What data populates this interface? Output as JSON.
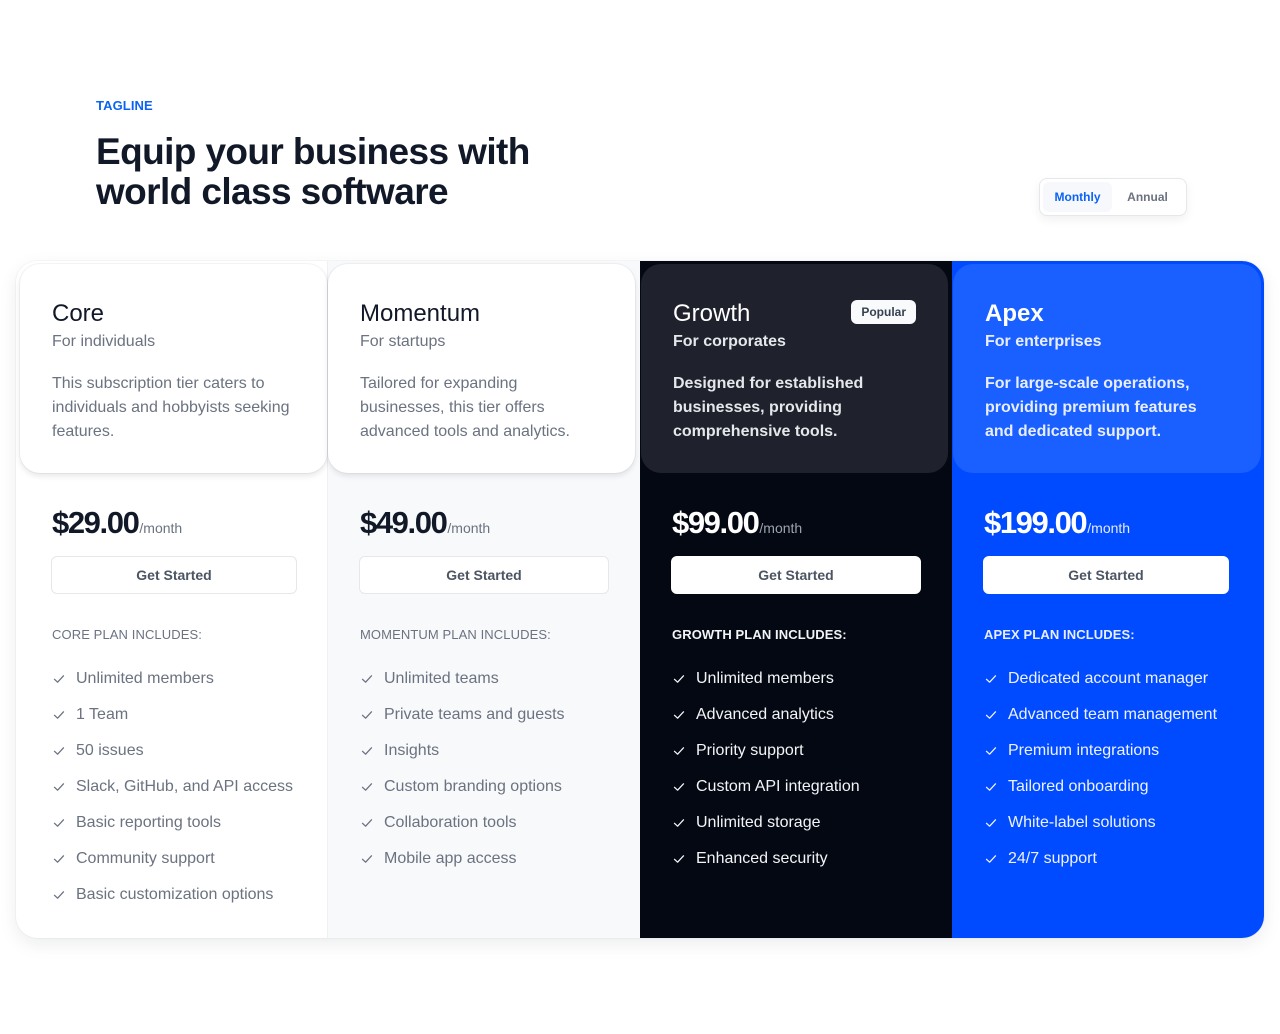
{
  "header": {
    "tagline": "TAGLINE",
    "title": "Equip your business with world class software"
  },
  "billing_toggle": {
    "options": [
      "Monthly",
      "Annual"
    ],
    "selected": "Monthly"
  },
  "colors": {
    "accent": "#0b63f6",
    "apex_bg": "#004bff",
    "growth_bg": "#040812"
  },
  "plans": [
    {
      "name": "Core",
      "audience": "For individuals",
      "description": "This subscription tier caters to individuals and hobbyists seeking features.",
      "price": "$29.00",
      "period": "/month",
      "cta": "Get Started",
      "includes_label": "CORE PLAN INCLUDES:",
      "features": [
        "Unlimited members",
        "1 Team",
        "50 issues",
        "Slack, GitHub, and API access",
        "Basic reporting tools",
        "Community support",
        "Basic customization options"
      ]
    },
    {
      "name": "Momentum",
      "audience": "For startups",
      "description": "Tailored for expanding businesses, this tier offers advanced tools and analytics.",
      "price": "$49.00",
      "period": "/month",
      "cta": "Get Started",
      "includes_label": "MOMENTUM PLAN INCLUDES:",
      "features": [
        "Unlimited teams",
        "Private teams and guests",
        "Insights",
        "Custom branding options",
        "Collaboration tools",
        "Mobile app access"
      ]
    },
    {
      "name": "Growth",
      "audience": "For corporates",
      "badge": "Popular",
      "description": "Designed for established businesses, providing comprehensive tools.",
      "price": "$99.00",
      "period": "/month",
      "cta": "Get Started",
      "includes_label": "GROWTH PLAN INCLUDES:",
      "features": [
        "Unlimited members",
        "Advanced analytics",
        "Priority support",
        "Custom API integration",
        "Unlimited storage",
        "Enhanced security"
      ]
    },
    {
      "name": "Apex",
      "audience": "For enterprises",
      "description": "For large-scale operations, providing premium features and dedicated support.",
      "price": "$199.00",
      "period": "/month",
      "cta": "Get Started",
      "includes_label": "APEX PLAN INCLUDES:",
      "features": [
        "Dedicated account manager",
        "Advanced team management",
        "Premium integrations",
        "Tailored onboarding",
        "White-label solutions",
        "24/7 support"
      ]
    }
  ]
}
